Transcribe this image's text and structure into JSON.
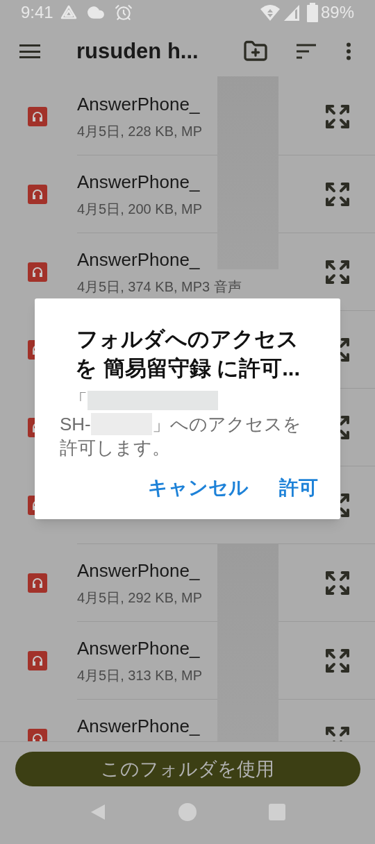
{
  "status_bar": {
    "time": "9:41",
    "battery": "89%"
  },
  "app_bar": {
    "title": "rusuden h..."
  },
  "files": [
    {
      "kind": "audio",
      "title": "AnswerPhone_",
      "subtitle": "4月5日, 228 KB, MP"
    },
    {
      "kind": "audio",
      "title": "AnswerPhone_",
      "subtitle": "4月5日, 200 KB, MP"
    },
    {
      "kind": "audio",
      "title": "AnswerPhone_",
      "subtitle": "4月5日, 374 KB, MP3 音声"
    },
    {
      "kind": "audio"
    },
    {
      "kind": "audio"
    },
    {
      "kind": "audio"
    },
    {
      "kind": "audio",
      "title": "AnswerPhone_",
      "subtitle": "4月5日, 292 KB, MP"
    },
    {
      "kind": "audio",
      "title": "AnswerPhone_",
      "subtitle": "4月5日, 313 KB, MP"
    },
    {
      "kind": "audio",
      "title": "AnswerPhone_"
    }
  ],
  "use_folder_button": "このフォルダを使用",
  "dialog": {
    "title": "フォルダへのアクセスを 簡易留守録 に許可...",
    "message": {
      "open_quote": "「",
      "prefix": "SH-",
      "line2_rest": "」へのアクセスを",
      "line3": "許可します。"
    },
    "buttons": [
      "キャンセル",
      "許可"
    ]
  }
}
